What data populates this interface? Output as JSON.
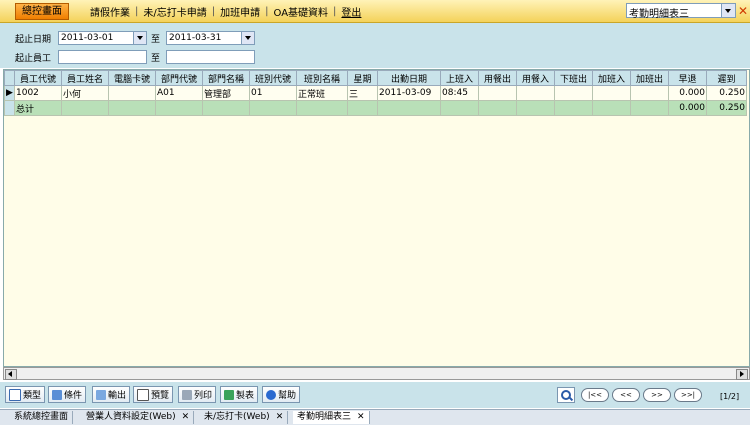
{
  "topbar": {
    "home_label": "總控畫面",
    "nav": [
      "請假作業",
      "未/忘打卡申請",
      "加班申請",
      "OA基礎資料",
      "登出"
    ],
    "report_selected": "考勤明細表三"
  },
  "filter": {
    "date_label": "起止日期",
    "emp_label": "起止員工",
    "to_label": "至",
    "date_from": "2011-03-01",
    "date_to": "2011-03-31",
    "emp_from": "",
    "emp_to": ""
  },
  "grid": {
    "columns": [
      "員工代號",
      "員工姓名",
      "電腦卡號",
      "部門代號",
      "部門名稱",
      "班別代號",
      "班別名稱",
      "星期",
      "出勤日期",
      "上班入",
      "用餐出",
      "用餐入",
      "下班出",
      "加班入",
      "加班出",
      "早退",
      "遲到"
    ],
    "rows": [
      [
        "1002",
        "小何",
        "",
        "A01",
        "管理部",
        "01",
        "正常班",
        "三",
        "2011-03-09",
        "08:45",
        "",
        "",
        "",
        "",
        "",
        "0.000",
        "0.250"
      ]
    ],
    "total": [
      "总计",
      "",
      "",
      "",
      "",
      "",
      "",
      "",
      "",
      "",
      "",
      "",
      "",
      "",
      "",
      "0.000",
      "0.250"
    ]
  },
  "toolbar": {
    "buttons": [
      "類型",
      "條件",
      "輸出",
      "預覽",
      "列印",
      "製表",
      "幫助"
    ],
    "pager": [
      "|<<",
      "<<",
      ">>",
      ">>|"
    ],
    "page_info": "[1/2]"
  },
  "tabs": [
    "系統總控畫面",
    "營業人資料設定(Web)",
    "未/忘打卡(Web)",
    "考勤明細表三"
  ],
  "colors": {
    "accent": "#f4d25a",
    "panel": "#c9e3ea",
    "total_row": "#b9e0b8"
  }
}
